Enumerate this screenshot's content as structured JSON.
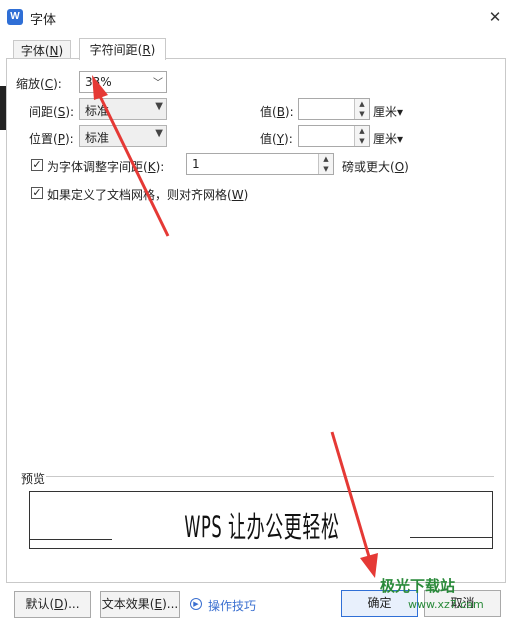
{
  "window": {
    "title": "字体",
    "app_icon_letter": "W",
    "close_glyph": "✕"
  },
  "tabs": [
    {
      "label": "字体(N)",
      "mnemonic_display": [
        "字体(",
        "N",
        ")"
      ]
    },
    {
      "label": "字符间距(R)",
      "mnemonic_display": [
        "字符间距(",
        "R",
        ")"
      ]
    }
  ],
  "form": {
    "scale": {
      "label_pre": "缩放(",
      "mnemonic": "C",
      "label_post": "):",
      "value": "33%"
    },
    "spacing": {
      "label_pre": "间距(",
      "mnemonic": "S",
      "label_post": "):",
      "value": "标准",
      "by_label_pre": "值(",
      "by_mnemonic": "B",
      "by_label_post": "):",
      "by_value": "",
      "unit": "厘米▾"
    },
    "position": {
      "label_pre": "位置(",
      "mnemonic": "P",
      "label_post": "):",
      "value": "标准",
      "by_label_pre": "值(",
      "by_mnemonic": "Y",
      "by_label_post": "):",
      "by_value": "",
      "unit": "厘米▾"
    },
    "kerning": {
      "checked": true,
      "label_pre": "为字体调整字间距(",
      "mnemonic": "K",
      "label_post": "):",
      "value": "1",
      "suffix_pre": "磅或更大(",
      "suffix_mnemonic": "O",
      "suffix_post": ")"
    },
    "grid": {
      "checked": true,
      "label_pre": "如果定义了文档网格，则对齐网格(",
      "mnemonic": "W",
      "label_post": ")"
    }
  },
  "preview": {
    "label": "预览",
    "sample_text": "WPS 让办公更轻松"
  },
  "footer": {
    "default_button": {
      "pre": "默认(",
      "mnemonic": "D",
      "post": ")..."
    },
    "text_effect_button": {
      "pre": "文本效果(",
      "mnemonic": "E",
      "post": ")..."
    },
    "tips_link": "操作技巧",
    "ok_button": "确定",
    "cancel_button": "取消"
  },
  "watermark": {
    "line1": "极光下载站",
    "line2": "www.xz7.com"
  },
  "colors": {
    "accent": "#2f6fd6",
    "annotation_arrow": "#e53935",
    "watermark": "#2a8a3a"
  },
  "annotations": [
    {
      "type": "arrow",
      "color": "red",
      "target": "scale-combo"
    },
    {
      "type": "arrow",
      "color": "red",
      "target": "ok-button"
    }
  ]
}
